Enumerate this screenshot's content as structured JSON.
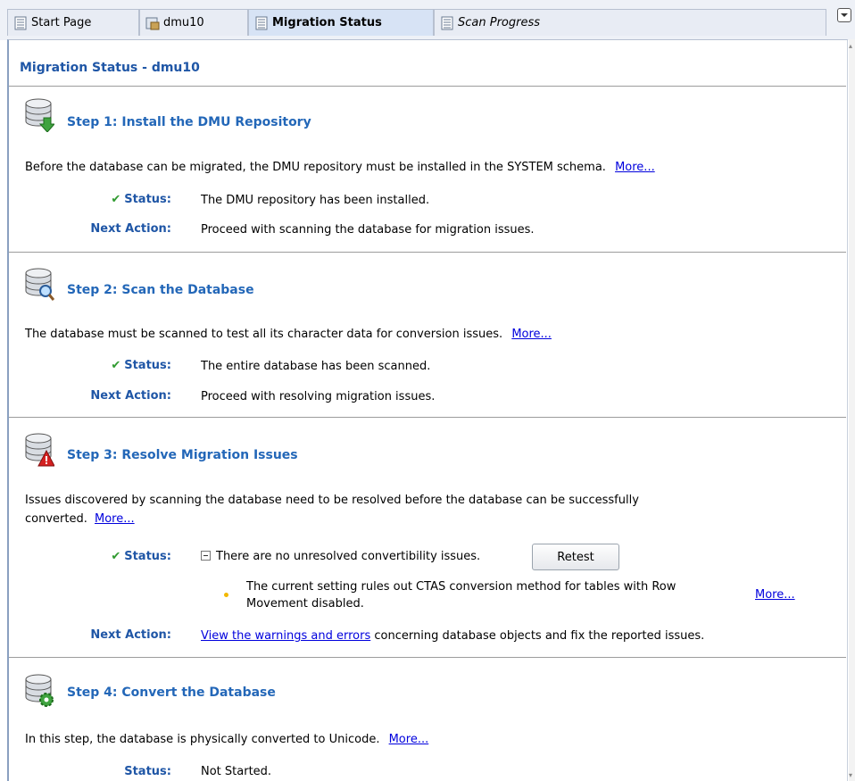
{
  "tabs": [
    {
      "label": "Start Page",
      "icon": "document-icon"
    },
    {
      "label": "dmu10",
      "icon": "database-connection-icon"
    },
    {
      "label": "Migration Status",
      "icon": "document-icon"
    },
    {
      "label": "Scan Progress",
      "icon": "document-icon"
    }
  ],
  "page_title": "Migration Status - dmu10",
  "labels": {
    "status": "Status:",
    "next_action": "Next Action:",
    "more": "More..."
  },
  "steps": [
    {
      "title": "Step 1: Install the DMU Repository",
      "icon": "database-install-icon",
      "description": "Before the database can be migrated, the DMU repository must be installed in the SYSTEM schema.",
      "status": "The DMU repository has been installed.",
      "next_action": "Proceed with scanning the database for migration issues."
    },
    {
      "title": "Step 2: Scan the Database",
      "icon": "database-scan-icon",
      "description": "The database must be scanned to test all its character data for conversion issues.",
      "status": "The entire database has been scanned.",
      "next_action": "Proceed with resolving migration issues."
    },
    {
      "title": "Step 3: Resolve Migration Issues",
      "icon": "database-warning-icon",
      "description_line1": "Issues discovered by scanning the database need to be resolved before the database can be successfully",
      "description_line2": "converted.",
      "status": "There are no unresolved convertibility issues.",
      "retest_label": "Retest",
      "warning_line1": "The current setting rules out CTAS conversion method for tables with Row",
      "warning_line2": "Movement disabled.",
      "next_action_link": "View the warnings and errors",
      "next_action_rest": " concerning database objects and fix the reported issues."
    },
    {
      "title": "Step 4: Convert the Database",
      "icon": "database-convert-icon",
      "description": "In this step, the database is physically converted to Unicode.",
      "status": "Not Started."
    }
  ],
  "colors": {
    "title_blue": "#1f56a6",
    "step_blue": "#2367b8",
    "check_green": "#2f9a2f",
    "link_blue": "#0000dd"
  }
}
